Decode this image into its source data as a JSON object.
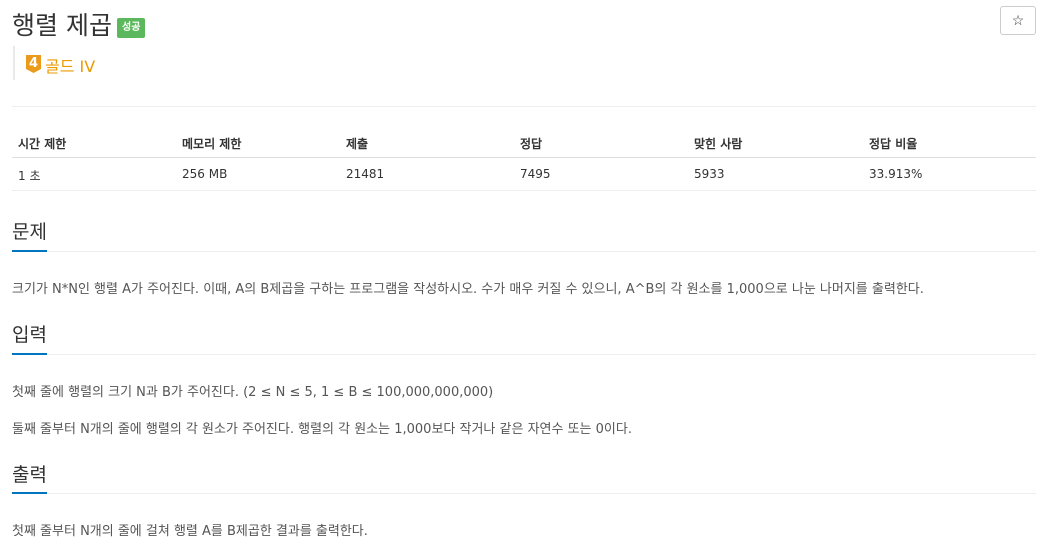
{
  "problem": {
    "title": "행렬 제곱",
    "status_badge": "성공",
    "tier": {
      "level": "4",
      "label": "골드 IV"
    }
  },
  "actions": {
    "favorite_icon": "☆"
  },
  "info_table": {
    "headers": [
      "시간 제한",
      "메모리 제한",
      "제출",
      "정답",
      "맞힌 사람",
      "정답 비율"
    ],
    "values": [
      "1 초",
      "256 MB",
      "21481",
      "7495",
      "5933",
      "33.913%"
    ]
  },
  "sections": {
    "problem": {
      "title": "문제",
      "paragraphs": [
        "크기가 N*N인 행렬 A가 주어진다. 이때, A의 B제곱을 구하는 프로그램을 작성하시오. 수가 매우 커질 수 있으니, A^B의 각 원소를 1,000으로 나눈 나머지를 출력한다."
      ]
    },
    "input": {
      "title": "입력",
      "paragraphs": [
        "첫째 줄에 행렬의 크기 N과 B가 주어진다. (2 ≤ N ≤  5, 1 ≤ B ≤ 100,000,000,000)",
        "둘째 줄부터 N개의 줄에 행렬의 각 원소가 주어진다. 행렬의 각 원소는 1,000보다 작거나 같은 자연수 또는 0이다."
      ]
    },
    "output": {
      "title": "출력",
      "paragraphs": [
        "첫째 줄부터 N개의 줄에 걸쳐 행렬 A를 B제곱한 결과를 출력한다."
      ]
    }
  },
  "colors": {
    "accent": "#0076c0",
    "success": "#5cb85c",
    "gold": "#ec9a00"
  }
}
